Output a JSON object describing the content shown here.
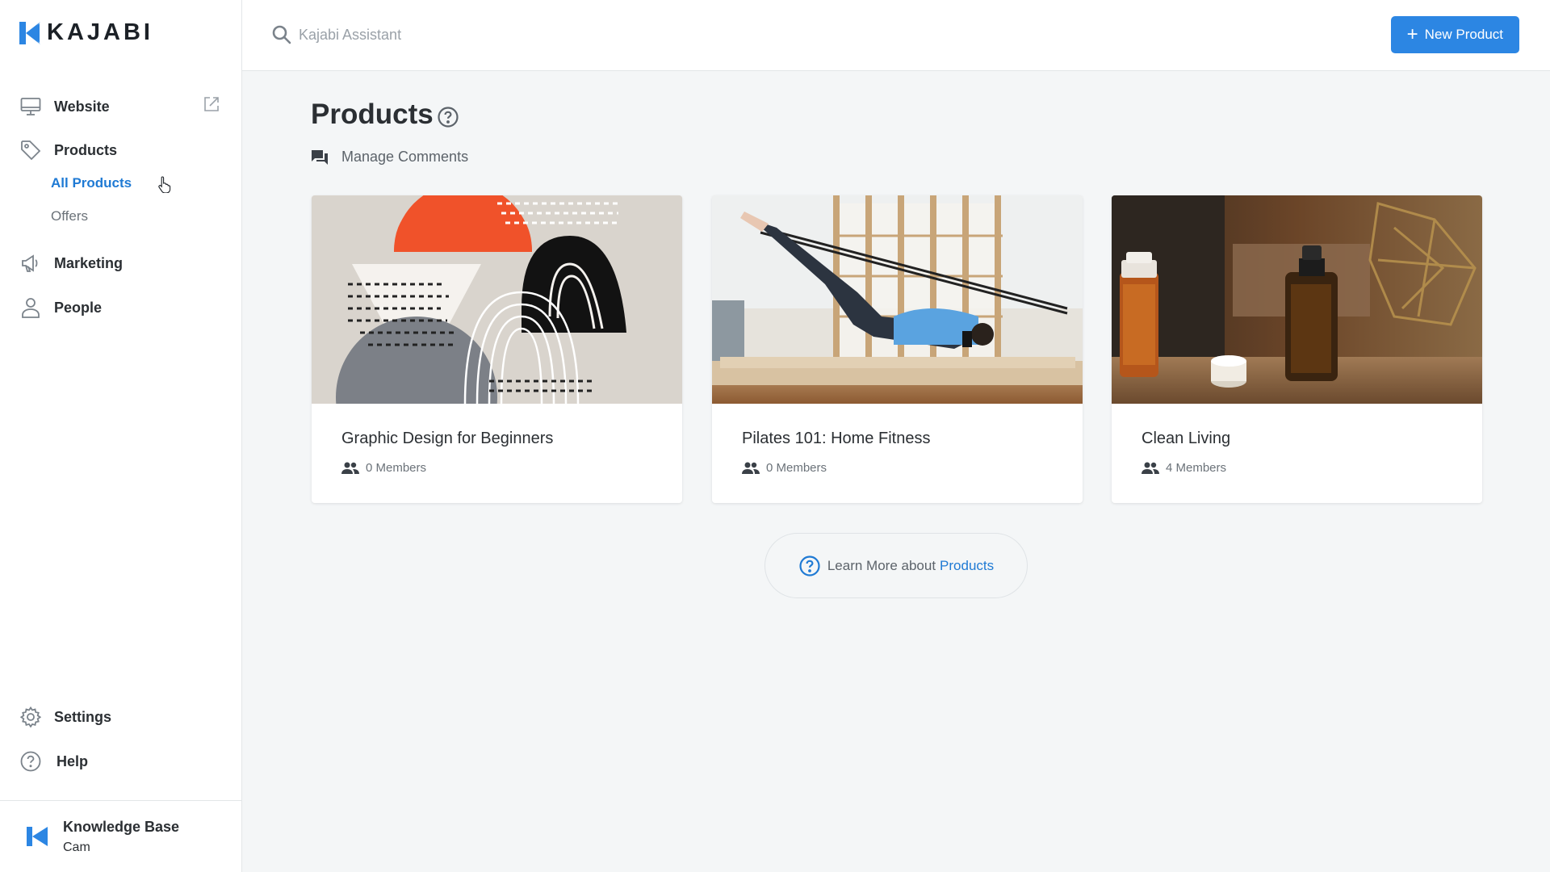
{
  "app": {
    "brand": "KAJABI",
    "brand_color": "#2c86e3"
  },
  "sidebar": {
    "website": {
      "label": "Website",
      "icon": "monitor-icon",
      "extra_icon": "external-link-icon"
    },
    "products": {
      "label": "Products",
      "icon": "tag-icon",
      "sub_items": [
        {
          "label": "All Products",
          "active": true
        },
        {
          "label": "Offers",
          "active": false
        }
      ]
    },
    "marketing": {
      "label": "Marketing",
      "icon": "megaphone-icon"
    },
    "people": {
      "label": "People",
      "icon": "person-icon"
    },
    "settings": {
      "label": "Settings",
      "icon": "gear-icon"
    },
    "help": {
      "label": "Help",
      "icon": "help-circle-icon"
    },
    "footer": {
      "title": "Knowledge Base",
      "user": "Cam",
      "icon": "kajabi-logo-icon"
    }
  },
  "topbar": {
    "search_placeholder": "Kajabi Assistant",
    "new_button_label": "New Product",
    "new_button_icon": "plus-icon"
  },
  "main": {
    "title": "Products",
    "manage_comments": "Manage Comments",
    "products": [
      {
        "title": "Graphic Design for Beginners",
        "members": "0 Members",
        "image": "abstract-shapes-illustration"
      },
      {
        "title": "Pilates 101: Home Fitness",
        "members": "0 Members",
        "image": "pilates-reformer-photo"
      },
      {
        "title": "Clean Living",
        "members": "4 Members",
        "image": "essential-oil-bottles-photo"
      }
    ],
    "learn_more": {
      "text": "Learn More about",
      "link": "Products"
    }
  }
}
